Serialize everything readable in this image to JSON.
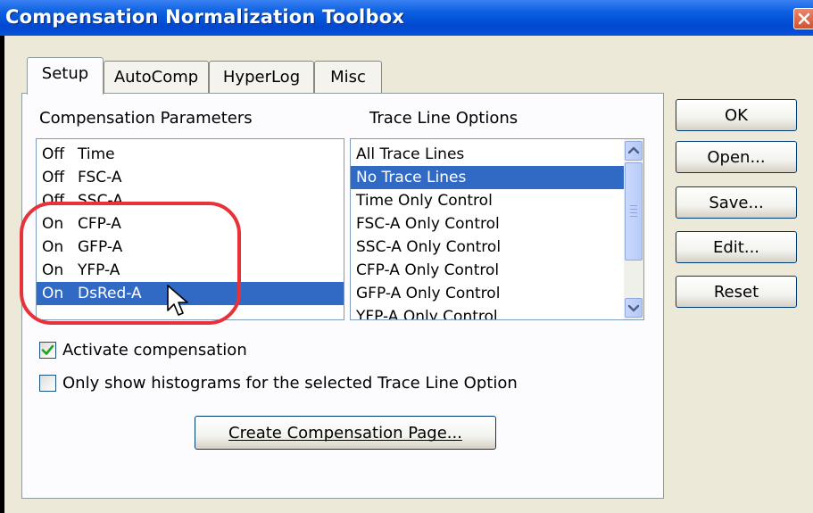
{
  "window": {
    "title": "Compensation Normalization Toolbox",
    "close_icon": "close-icon"
  },
  "tabs": [
    {
      "label": "Setup",
      "active": true
    },
    {
      "label": "AutoComp",
      "active": false
    },
    {
      "label": "HyperLog",
      "active": false
    },
    {
      "label": "Misc",
      "active": false
    }
  ],
  "compensation": {
    "label": "Compensation Parameters",
    "items": [
      {
        "state": "Off",
        "param": "Time",
        "selected": false
      },
      {
        "state": "Off",
        "param": "FSC-A",
        "selected": false
      },
      {
        "state": "Off",
        "param": "SSC-A",
        "selected": false
      },
      {
        "state": "On",
        "param": "CFP-A",
        "selected": false
      },
      {
        "state": "On",
        "param": "GFP-A",
        "selected": false
      },
      {
        "state": "On",
        "param": "YFP-A",
        "selected": false
      },
      {
        "state": "On",
        "param": "DsRed-A",
        "selected": true
      }
    ]
  },
  "trace": {
    "label": "Trace Line Options",
    "items": [
      {
        "label": "All Trace Lines",
        "selected": false
      },
      {
        "label": "No Trace Lines",
        "selected": true
      },
      {
        "label": "Time Only Control",
        "selected": false
      },
      {
        "label": "FSC-A Only Control",
        "selected": false
      },
      {
        "label": "SSC-A Only Control",
        "selected": false
      },
      {
        "label": "CFP-A Only Control",
        "selected": false
      },
      {
        "label": "GFP-A Only Control",
        "selected": false
      },
      {
        "label": "YFP-A Only Control",
        "selected": false
      }
    ]
  },
  "options": {
    "activate_label": "Activate compensation",
    "activate_checked": true,
    "only_show_label": "Only show histograms for the selected Trace Line Option",
    "only_show_checked": false
  },
  "buttons": {
    "create_page": "Create Compensation Page...",
    "ok": "OK",
    "open": "Open...",
    "save": "Save...",
    "edit": "Edit...",
    "reset": "Reset"
  },
  "colors": {
    "titlebar": "#0048d0",
    "selection": "#316ac5",
    "annotation_ring": "#e8323a",
    "dialog_bg": "#ece9d8"
  }
}
